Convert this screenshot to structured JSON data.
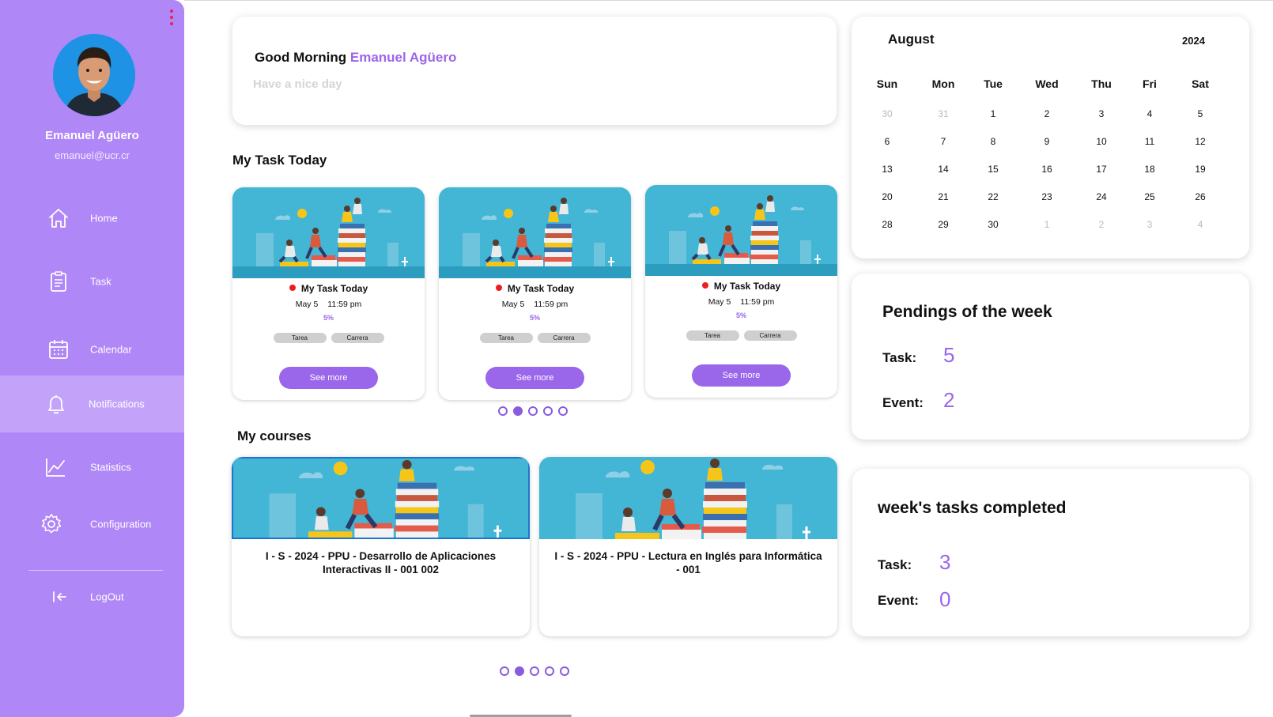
{
  "sidebar": {
    "user": {
      "name": "Emanuel Agüero",
      "email": "emanuel@ucr.cr"
    },
    "items": [
      {
        "label": "Home",
        "icon": "home-icon"
      },
      {
        "label": "Task",
        "icon": "clipboard-icon"
      },
      {
        "label": "Calendar",
        "icon": "calendar-icon"
      },
      {
        "label": "Notifications",
        "icon": "bell-icon",
        "active": true
      },
      {
        "label": "Statistics",
        "icon": "chart-line-icon"
      },
      {
        "label": "Configuration",
        "icon": "gear-icon"
      },
      {
        "label": "LogOut",
        "icon": "logout-icon"
      }
    ],
    "accent_color": "#b087f7"
  },
  "greeting": {
    "prefix": "Good Morning",
    "name": "Emanuel Agüero",
    "subtitle": "Have a nice day"
  },
  "tasks_section": {
    "title": "My Task Today"
  },
  "tasks": [
    {
      "title": "My Task Today",
      "date": "May 5",
      "time": "11:59 pm",
      "progress": "5%",
      "tags": [
        "Tarea",
        "Carrera"
      ],
      "button": "See more"
    },
    {
      "title": "My Task Today",
      "date": "May 5",
      "time": "11:59 pm",
      "progress": "5%",
      "tags": [
        "Tarea",
        "Carrera"
      ],
      "button": "See more"
    },
    {
      "title": "My Task Today",
      "date": "May 5",
      "time": "11:59 pm",
      "progress": "5%",
      "tags": [
        "Tarea",
        "Carrera"
      ],
      "button": "See more"
    }
  ],
  "tasks_pagination": {
    "pages": 5,
    "current": 2
  },
  "courses_section": {
    "title": "My courses"
  },
  "courses": [
    {
      "title": "I - S - 2024 - PPU - Desarrollo de Aplicaciones Interactivas II - 001 002",
      "selected": true
    },
    {
      "title": "I - S - 2024 - PPU - Lectura en Inglés para Informática - 001",
      "selected": false
    }
  ],
  "courses_pagination": {
    "pages": 5,
    "current": 2
  },
  "calendar": {
    "month": "August",
    "year": "2024",
    "weekdays": [
      "Sun",
      "Mon",
      "Tue",
      "Wed",
      "Thu",
      "Fri",
      "Sat"
    ],
    "weeks": [
      [
        [
          "30",
          true
        ],
        [
          "31",
          true
        ],
        [
          "1",
          false
        ],
        [
          "2",
          false
        ],
        [
          "3",
          false
        ],
        [
          "4",
          false
        ],
        [
          "5",
          false
        ]
      ],
      [
        [
          "6",
          false
        ],
        [
          "7",
          false
        ],
        [
          "8",
          false
        ],
        [
          "9",
          false
        ],
        [
          "10",
          false
        ],
        [
          "11",
          false
        ],
        [
          "12",
          false
        ]
      ],
      [
        [
          "13",
          false
        ],
        [
          "14",
          false
        ],
        [
          "15",
          false
        ],
        [
          "16",
          false
        ],
        [
          "17",
          false
        ],
        [
          "18",
          false
        ],
        [
          "19",
          false
        ]
      ],
      [
        [
          "20",
          false
        ],
        [
          "21",
          false
        ],
        [
          "22",
          false
        ],
        [
          "23",
          false
        ],
        [
          "24",
          false
        ],
        [
          "25",
          false
        ],
        [
          "26",
          false
        ]
      ],
      [
        [
          "28",
          false
        ],
        [
          "29",
          false
        ],
        [
          "30",
          false
        ],
        [
          "1",
          true
        ],
        [
          "2",
          true
        ],
        [
          "3",
          true
        ],
        [
          "4",
          true
        ]
      ]
    ]
  },
  "pendings": {
    "title": "Pendings of the week",
    "task_label": "Task:",
    "task_value": "5",
    "event_label": "Event:",
    "event_value": "2"
  },
  "completed": {
    "title": "week's tasks completed",
    "task_label": "Task:",
    "task_value": "3",
    "event_label": "Event:",
    "event_value": "0"
  },
  "colors": {
    "accent": "#9a66ea",
    "sidebar": "#b087f7",
    "active_item": "#c3a3fa",
    "alert_dot": "#ef1c1c"
  }
}
